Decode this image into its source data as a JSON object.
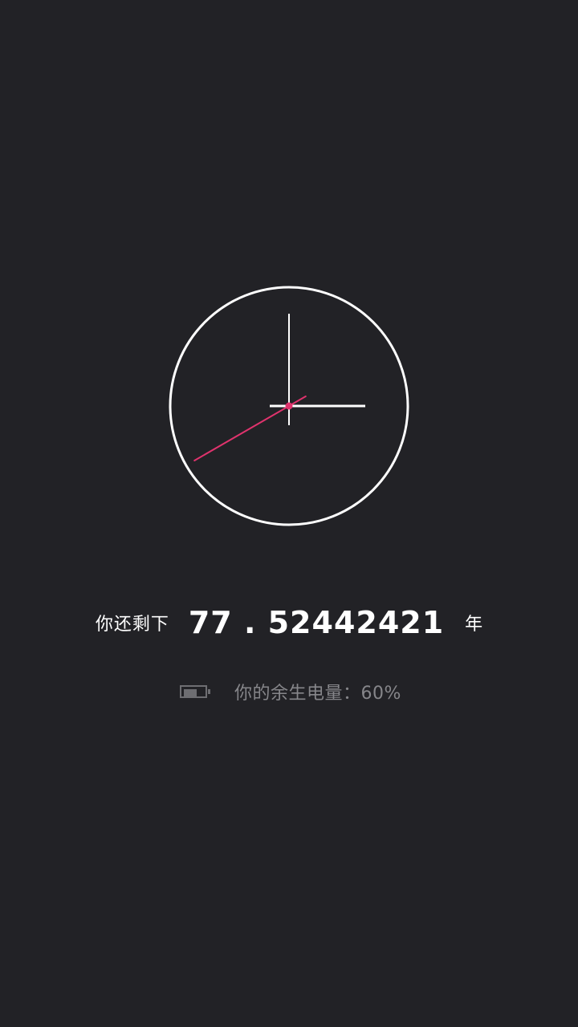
{
  "clock": {
    "hour_hand_angle_deg": 90,
    "minute_hand_angle_deg": 0,
    "second_hand_angle_deg": 240,
    "face_color": "#ffffff",
    "second_hand_color": "#e0336d"
  },
  "remaining": {
    "prefix": "你还剩下",
    "value": "77 . 52442421",
    "unit": "年"
  },
  "battery": {
    "label": "你的余生电量：60%",
    "level": 0.6,
    "color": "#6e6e72"
  },
  "colors": {
    "background": "#222226",
    "primary_text": "#ffffff",
    "secondary_text": "#86868a"
  }
}
